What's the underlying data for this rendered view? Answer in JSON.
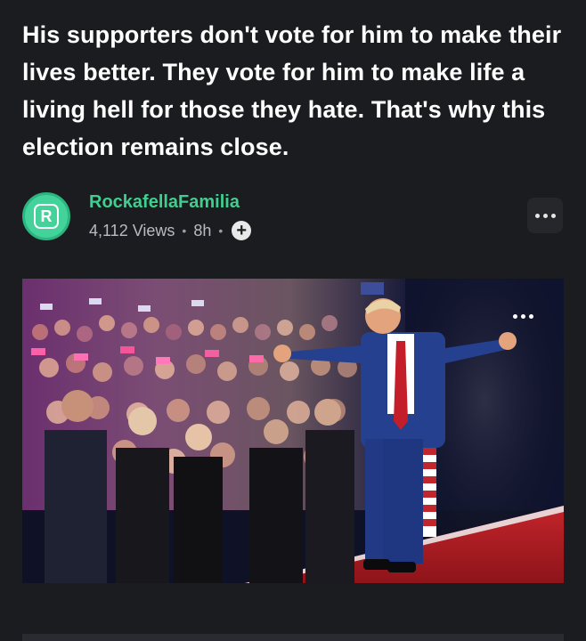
{
  "post": {
    "title": "His supporters don't vote for him to make their lives better. They vote for him to make life a living hell for those they hate. That's why this election remains close.",
    "author": {
      "name": "RockafellaFamilia",
      "avatar_letter": "R",
      "avatar_color": "#43d29a",
      "name_color": "#3fcf8e"
    },
    "views": "4,112 Views",
    "separator": "•",
    "time": "8h",
    "follow_icon": "plus-icon",
    "menu_icon": "more-horizontal-icon"
  },
  "media": {
    "menu_icon": "more-horizontal-icon"
  }
}
